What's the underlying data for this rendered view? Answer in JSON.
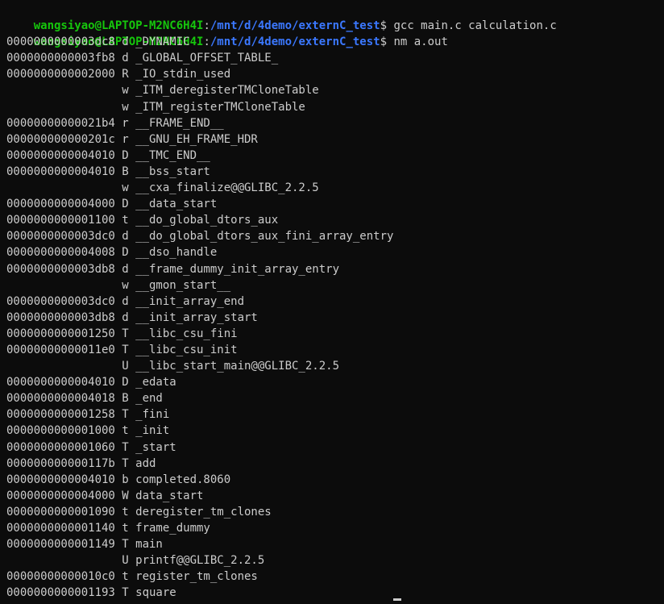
{
  "terminal": {
    "commands": [
      {
        "user": "wangsiyao@LAPTOP-M2NC6H4I",
        "sep": ":",
        "path": "/mnt/d/4demo/externC_test",
        "dollar": "$",
        "cmd": " gcc main.c calculation.c"
      },
      {
        "user": "wangsiyao@LAPTOP-M2NC6H4I",
        "sep": ":",
        "path": "/mnt/d/4demo/externC_test",
        "dollar": "$",
        "cmd": " nm a.out"
      }
    ],
    "symbols": [
      "0000000000003dc8 d _DYNAMIC",
      "0000000000003fb8 d _GLOBAL_OFFSET_TABLE_",
      "0000000000002000 R _IO_stdin_used",
      "                 w _ITM_deregisterTMCloneTable",
      "                 w _ITM_registerTMCloneTable",
      "00000000000021b4 r __FRAME_END__",
      "000000000000201c r __GNU_EH_FRAME_HDR",
      "0000000000004010 D __TMC_END__",
      "0000000000004010 B __bss_start",
      "                 w __cxa_finalize@@GLIBC_2.2.5",
      "0000000000004000 D __data_start",
      "0000000000001100 t __do_global_dtors_aux",
      "0000000000003dc0 d __do_global_dtors_aux_fini_array_entry",
      "0000000000004008 D __dso_handle",
      "0000000000003db8 d __frame_dummy_init_array_entry",
      "                 w __gmon_start__",
      "0000000000003dc0 d __init_array_end",
      "0000000000003db8 d __init_array_start",
      "0000000000001250 T __libc_csu_fini",
      "00000000000011e0 T __libc_csu_init",
      "                 U __libc_start_main@@GLIBC_2.2.5",
      "0000000000004010 D _edata",
      "0000000000004018 B _end",
      "0000000000001258 T _fini",
      "0000000000001000 t _init",
      "0000000000001060 T _start",
      "000000000000117b T add",
      "0000000000004010 b completed.8060",
      "0000000000004000 W data_start",
      "0000000000001090 t deregister_tm_clones",
      "0000000000001140 t frame_dummy",
      "0000000000001149 T main",
      "                 U printf@@GLIBC_2.2.5",
      "00000000000010c0 t register_tm_clones",
      "0000000000001193 T square"
    ]
  },
  "colors": {
    "background": "#0c0c0c",
    "text": "#cccccc",
    "prompt_user": "#16c60c",
    "prompt_path": "#3b78ff"
  }
}
